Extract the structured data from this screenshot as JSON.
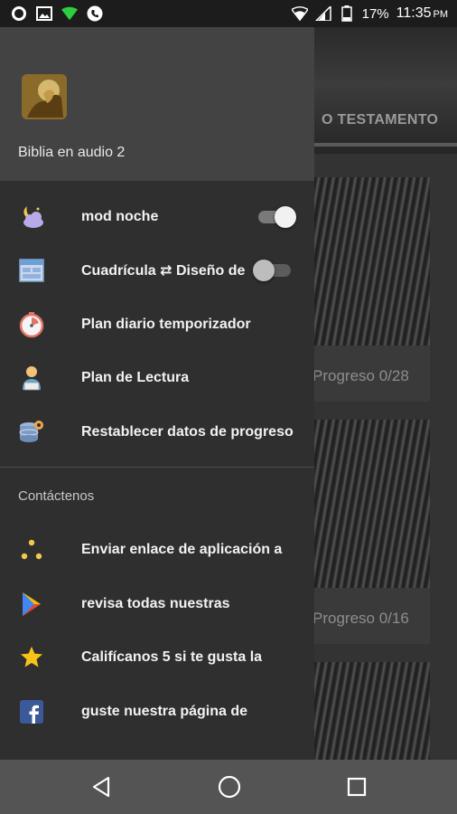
{
  "status_bar": {
    "battery_percent": "17%",
    "time": "11:35",
    "ampm": "PM"
  },
  "background": {
    "tab_label": "O TESTAMENTO",
    "progress_1": "Progreso 0/28",
    "progress_2": "Progreso 0/16"
  },
  "drawer": {
    "app_title": "Biblia en audio 2",
    "items": [
      {
        "label": "mod noche",
        "icon": "moon-cloud-icon",
        "toggle": "on"
      },
      {
        "label": "Cuadrícula ⇄ Diseño de",
        "icon": "grid-layout-icon",
        "toggle": "off"
      },
      {
        "label": "Plan diario temporizador",
        "icon": "timer-icon"
      },
      {
        "label": "Plan de Lectura",
        "icon": "reader-person-icon"
      },
      {
        "label": "Restablecer datos de progreso",
        "icon": "database-gear-icon"
      }
    ],
    "contact_section_title": "Contáctenos",
    "contact_items": [
      {
        "label": "Enviar enlace de aplicación a",
        "icon": "share-dots-icon"
      },
      {
        "label": "revisa todas nuestras",
        "icon": "play-store-icon"
      },
      {
        "label": "Califícanos 5 si te gusta la",
        "icon": "star-icon"
      },
      {
        "label": "guste nuestra página de",
        "icon": "facebook-icon"
      }
    ]
  },
  "colors": {
    "drawer_bg": "#2f2f2f",
    "drawer_header_bg": "#434343",
    "status_bar_bg": "#1c1c1c",
    "nav_bar_bg": "#545454",
    "wifi_green": "#2ecc40"
  }
}
